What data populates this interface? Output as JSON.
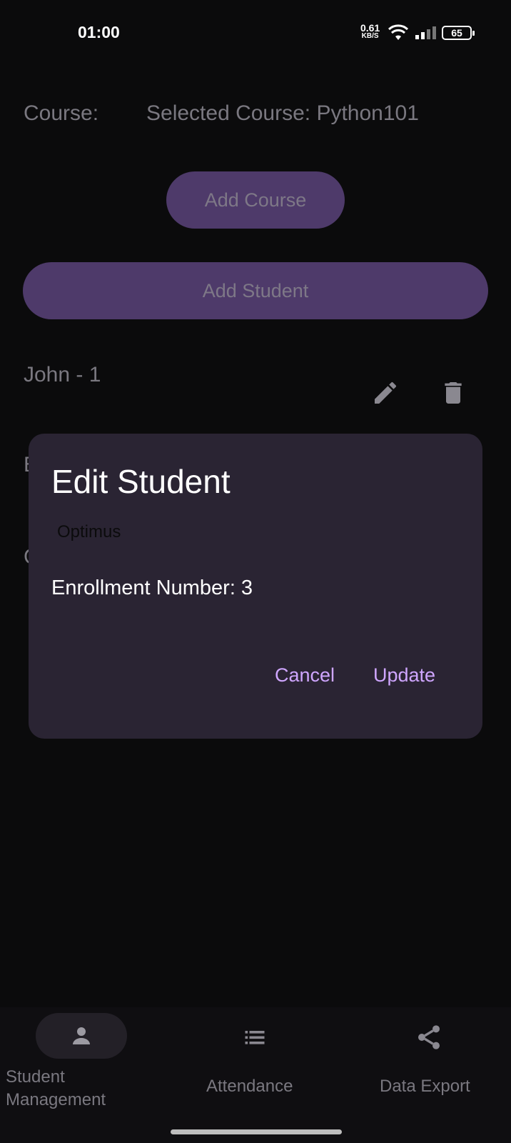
{
  "status_bar": {
    "time": "01:00",
    "net_speed_value": "0.61",
    "net_speed_unit": "KB/S",
    "battery": "65",
    "icons": [
      "wifi-icon",
      "signal-icon",
      "battery-icon"
    ]
  },
  "course": {
    "label": "Course:",
    "selected": "Selected Course: Python101",
    "add_course_button": "Add Course"
  },
  "add_student_button": "Add Student",
  "students": [
    {
      "display": "John - 1"
    },
    {
      "display": "E"
    },
    {
      "display": "C"
    }
  ],
  "dialog": {
    "title": "Edit Student",
    "name_value": "Optimus",
    "enrollment": "Enrollment Number: 3",
    "cancel": "Cancel",
    "update": "Update"
  },
  "bottom_nav": {
    "items": [
      {
        "label_line1": "Student",
        "label_line2": "Management",
        "icon": "person-icon",
        "selected": true
      },
      {
        "label": "Attendance",
        "icon": "list-icon",
        "selected": false
      },
      {
        "label": "Data Export",
        "icon": "share-icon",
        "selected": false
      }
    ]
  },
  "colors": {
    "background": "#0b0b0c",
    "button_bg": "#4e3a6a",
    "dialog_bg": "#2a2433",
    "accent_text": "#cfa6ff"
  }
}
